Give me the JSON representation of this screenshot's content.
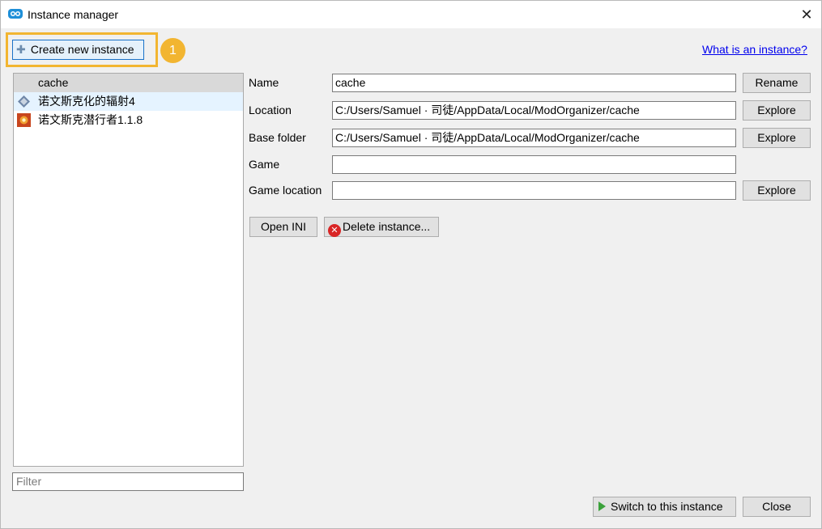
{
  "window": {
    "title": "Instance manager",
    "close_glyph": "✕"
  },
  "toolbar": {
    "create_label": "Create new instance",
    "plus_glyph": "✚",
    "step_badge": "1",
    "help_link": "What is an instance?"
  },
  "instances": [
    {
      "name": "cache",
      "icon": "none",
      "selected": true
    },
    {
      "name": "诺文斯克化的辐射4",
      "icon": "fallout4-icon",
      "hovered": true
    },
    {
      "name": "诺文斯克潜行者1.1.8",
      "icon": "stalker-icon"
    }
  ],
  "filter": {
    "placeholder": "Filter"
  },
  "details": {
    "name_label": "Name",
    "name_value": "cache",
    "rename_label": "Rename",
    "location_label": "Location",
    "location_value": "C:/Users/Samuel · 司徒/AppData/Local/ModOrganizer/cache",
    "base_label": "Base folder",
    "base_value": "C:/Users/Samuel · 司徒/AppData/Local/ModOrganizer/cache",
    "explore_label": "Explore",
    "game_label": "Game",
    "game_value": "",
    "game_location_label": "Game location",
    "game_location_value": ""
  },
  "actions": {
    "open_ini": "Open INI",
    "delete_instance": "Delete instance...",
    "delete_glyph": "✕",
    "switch": "Switch to this instance",
    "close": "Close"
  },
  "colors": {
    "highlight": "#f2b531",
    "link": "#0000ee",
    "selected_row": "#d9d9d9"
  }
}
